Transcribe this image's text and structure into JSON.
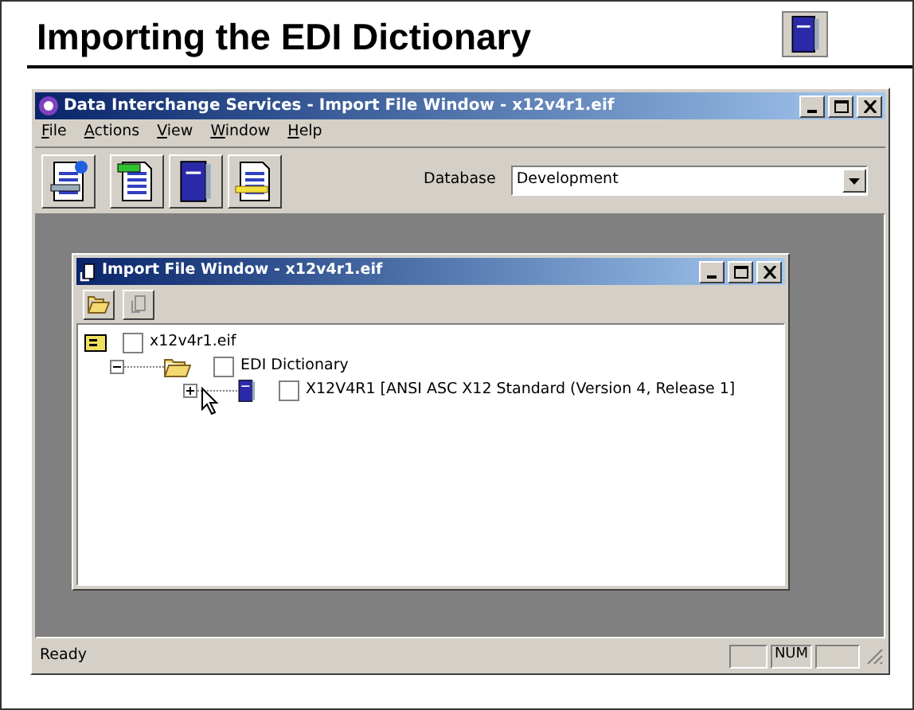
{
  "slide": {
    "title": "Importing the EDI Dictionary"
  },
  "window": {
    "title": "Data Interchange Services - Import File Window - x12v4r1.eif"
  },
  "menu": [
    "File",
    "Actions",
    "View",
    "Window",
    "Help"
  ],
  "toolbar": {
    "database_label": "Database",
    "database_value": "Development"
  },
  "child_window": {
    "title": "Import File Window - x12v4r1.eif",
    "tree": [
      {
        "label": "x12v4r1.eif",
        "checked": false,
        "children": [
          {
            "label": "EDI Dictionary",
            "checked": false,
            "expanded": true,
            "children": [
              {
                "label": "X12V4R1 [ANSI ASC X12 Standard (Version 4, Release 1]",
                "checked": false,
                "expanded": false
              }
            ]
          }
        ]
      }
    ]
  },
  "status_bar": {
    "text": "Ready",
    "indicator": "NUM"
  }
}
